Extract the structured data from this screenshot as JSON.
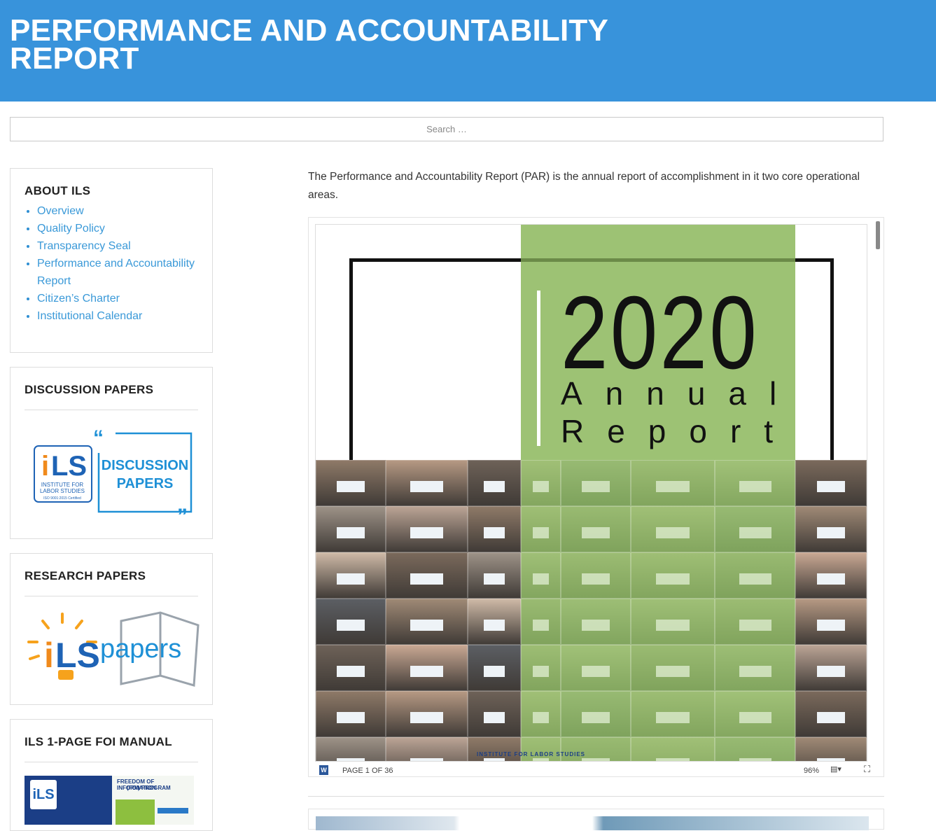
{
  "header": {
    "title": "PERFORMANCE AND ACCOUNTABILITY REPORT"
  },
  "search": {
    "placeholder": "Search …"
  },
  "sidebar": {
    "about": {
      "heading": "ABOUT ILS",
      "items": [
        {
          "label": "Overview"
        },
        {
          "label": "Quality Policy"
        },
        {
          "label": "Transparency Seal"
        },
        {
          "label": "Performance and Accountability Report"
        },
        {
          "label": "Citizen’s Charter"
        },
        {
          "label": "Institutional Calendar"
        }
      ]
    },
    "discussion": {
      "heading": "DISCUSSION PAPERS",
      "logo_text_1": "DISCUSSION",
      "logo_text_2": "PAPERS",
      "ils_small_1": "INSTITUTE FOR",
      "ils_small_2": "LABOR STUDIES",
      "ils_small_3": "ISO 9001:2015 Certified"
    },
    "research": {
      "heading": "RESEARCH PAPERS",
      "logo_text": "papers"
    },
    "foi": {
      "heading": "ILS 1-PAGE FOI MANUAL",
      "thumb_title_1": "FREEDOM OF INFORMATION",
      "thumb_title_2": "(FOI) PROGRAM"
    }
  },
  "main": {
    "intro": "The Performance and Accountability Report (PAR) is the annual report of accomplishment in it two core operational areas.",
    "document": {
      "year": "2020",
      "line1": "Annual",
      "line2": "Report",
      "footer_text": "INSTITUTE FOR LABOR STUDIES"
    },
    "viewer_toolbar": {
      "page_indicator": "PAGE 1 OF 36",
      "zoom": "96%"
    }
  },
  "colors": {
    "header_bg": "#3893db",
    "link": "#3a99d8",
    "cover_green": "#9dc274"
  }
}
